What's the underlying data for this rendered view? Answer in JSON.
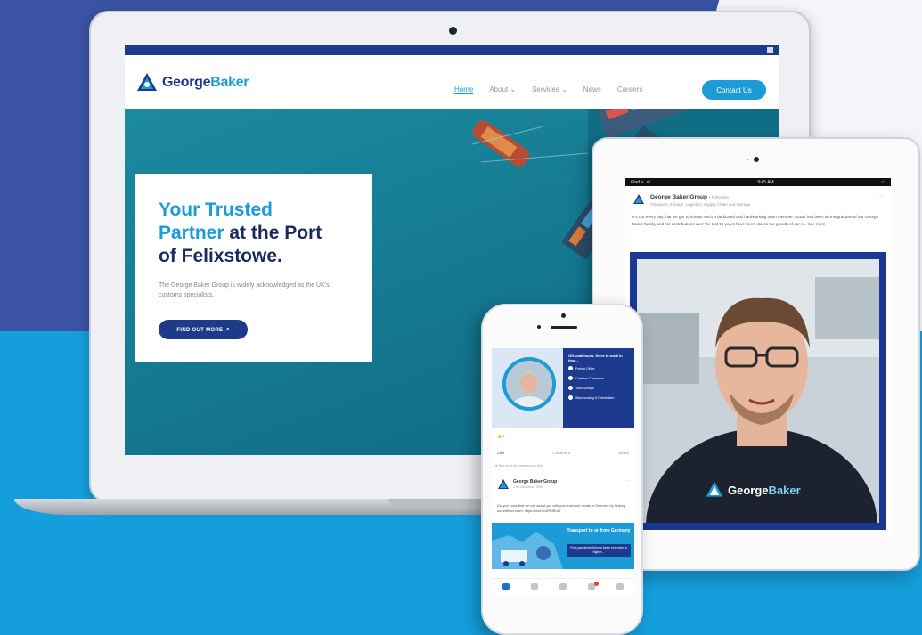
{
  "colors": {
    "navy": "#1e3a8a",
    "brand_blue": "#1d9bd7",
    "bg_dark": "#3a53a4",
    "bg_light": "#149fdc"
  },
  "laptop": {
    "site": {
      "logo_primary": "George",
      "logo_secondary": "Baker",
      "nav": [
        {
          "label": "Home"
        },
        {
          "label": "About ⌄"
        },
        {
          "label": "Services ⌄"
        },
        {
          "label": "News"
        },
        {
          "label": "Careers"
        }
      ],
      "cta_label": "Contact Us",
      "hero": {
        "title_line1": "Your Trusted",
        "title_line2_highlight": "Partner",
        "title_line2_rest": " at the Port",
        "title_line3": "of Felixstowe.",
        "text": "The George Baker Group is widely acknowledged as the UK's customs specialists.",
        "button_label": "FIND OUT MORE  ↗"
      }
    }
  },
  "tablet": {
    "status_left": "iPad ⚡ .ııl",
    "status_center": "9:45 AM",
    "status_right": "▭",
    "post": {
      "author": "George Baker Group",
      "author_meta": "• Following",
      "sub": "Transport, Storage, Logistics, Supply Chain and Storage",
      "more": "···",
      "body": "It's not every day that we get to honour such a dedicated and hardworking team member. Stuart has been an integral part of our George Baker family, and his contributions over the last 10 years have been vital to the growth of our c...",
      "see_more": "See more",
      "photo_logo_primary": "George",
      "photo_logo_secondary": "Baker"
    }
  },
  "phone": {
    "banner": {
      "heading": "Off-peak hours. Drive to work in time...",
      "items": [
        {
          "label": "Freight Office"
        },
        {
          "label": "Customs Clearance"
        },
        {
          "label": "Tank Storage"
        },
        {
          "label": "Warehousing & Distribution"
        }
      ]
    },
    "reactions": "👍 5",
    "actions": {
      "like": "Like",
      "comment": "Comment",
      "share": "Share"
    },
    "separator": "● See more to comment on this",
    "post2": {
      "author": "George Baker Group",
      "meta": "4.6K followers",
      "time": "22m",
      "more": "···",
      "body": "Did you know that we can assist you with your transport needs in Germany by helping our selfless team. https://lnkd.in/dRPfRuW",
      "img_tag": "Transport to or from Germany",
      "img_sub": "Post-pandemic there's been extended a higher..."
    }
  }
}
